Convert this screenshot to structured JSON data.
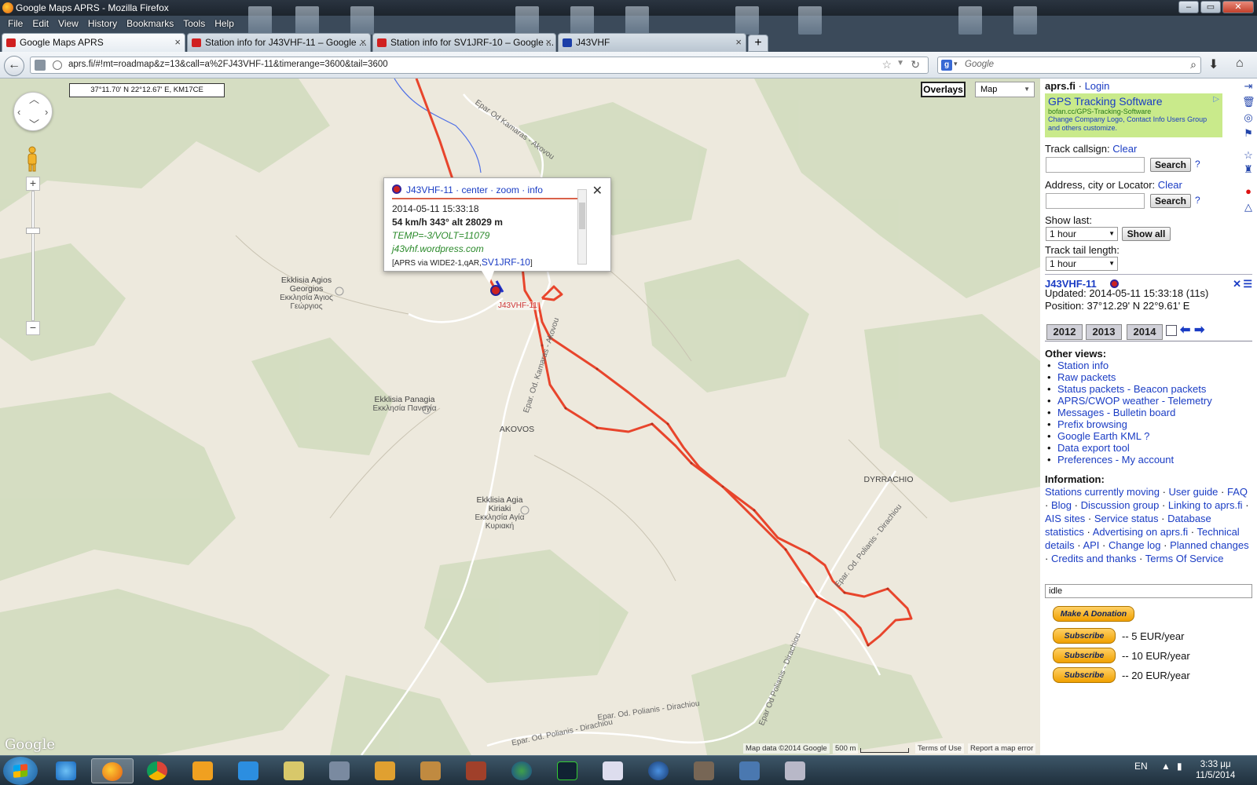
{
  "window": {
    "title": "Google Maps APRS - Mozilla Firefox"
  },
  "menu": [
    "File",
    "Edit",
    "View",
    "History",
    "Bookmarks",
    "Tools",
    "Help"
  ],
  "tabs": [
    {
      "label": "Google Maps APRS",
      "icon": "car-icon"
    },
    {
      "label": "Station info for J43VHF-11 – Google ...",
      "icon": "car-icon"
    },
    {
      "label": "Station info for SV1JRF-10 – Google ...",
      "icon": "car-icon"
    },
    {
      "label": "J43VHF",
      "icon": "blog-icon"
    }
  ],
  "nav": {
    "url": "aprs.fi/#!mt=roadmap&z=13&call=a%2FJ43VHF-11&timerange=3600&tail=3600",
    "search_placeholder": "Google"
  },
  "map": {
    "coords": "37°11.70' N 22°12.67' E, KM17CE",
    "overlays_label": "Overlays",
    "maptype_value": "Map",
    "places": [
      {
        "name": "Ekklisia Agios Georgios",
        "alt": "Εκκλησία Άγιος Γεώργιος"
      },
      {
        "name": "Ekklisia Panagia",
        "alt": "Εκκλησία Παναγία"
      },
      {
        "name": "AKOVOS"
      },
      {
        "name": "Ekklisia Agia Kiriaki",
        "alt": "Εκκλησία Αγία Κυριακή"
      },
      {
        "name": "DYRRACHIO"
      }
    ],
    "road_labels": [
      "Epar Od Kamaras - Akovou",
      "Epar. Od. Kamaras - Akovou",
      "Epar. Od. Polianis - Dirachiou",
      "Epar Od Polianis - Dirachiou",
      "Epar. Od. Polianis - Dirachiou",
      "Epar. Od. Polianis - Dirachiou"
    ],
    "station_label": "J43VHF-11",
    "footer": {
      "logo": "Google",
      "mapdata": "Map data ©2014 Google",
      "scale": "500 m",
      "terms": "Terms of Use",
      "report": "Report a map error"
    }
  },
  "infowindow": {
    "callsign": "J43VHF-11",
    "links": [
      "center",
      "zoom",
      "info"
    ],
    "time": "2014-05-11 15:33:18",
    "speed": "54 km/h 343° alt 28029 m",
    "comment": "TEMP=-3/VOLT=11079",
    "web": "j43vhf.wordpress.com",
    "via_prefix": "[APRS via WIDE2-1,qAR,",
    "via_call": "SV1JRF-10",
    "via_suffix": "]"
  },
  "sidebar": {
    "site": "aprs.fi",
    "login": "Login",
    "ad": {
      "title": "GPS Tracking Software",
      "url": "bofan.cc/GPS-Tracking-Software",
      "desc": "Change Company Logo, Contact Info Users Group and others customize."
    },
    "track_callsign_label": "Track callsign:",
    "address_label": "Address, city or Locator:",
    "clear": "Clear",
    "search": "Search",
    "qmark": "?",
    "show_last_label": "Show last:",
    "show_last_value": "1 hour",
    "show_all": "Show all",
    "tail_label": "Track tail length:",
    "tail_value": "1 hour",
    "station": {
      "callsign": "J43VHF-11",
      "updated": "Updated: 2014-05-11 15:33:18 (11s)",
      "position": "Position: 37°12.29' N 22°9.61' E"
    },
    "years": [
      "2012",
      "2013",
      "2014"
    ],
    "other_views_label": "Other views:",
    "views": [
      "Station info",
      "Raw packets",
      "Status packets - Beacon packets",
      "APRS/CWOP weather - Telemetry",
      "Messages - Bulletin board",
      "Prefix browsing",
      "Google Earth KML ?",
      "Data export tool",
      "Preferences - My account"
    ],
    "information_label": "Information:",
    "info_links": [
      "Stations currently moving",
      "User guide",
      "FAQ",
      "Blog",
      "Discussion group",
      "Linking to aprs.fi",
      "AIS sites",
      "Service status",
      "Database statistics",
      "Advertising on aprs.fi",
      "Technical details",
      "API",
      "Change log",
      "Planned changes",
      "Credits and thanks",
      "Terms Of Service"
    ],
    "status": "idle",
    "donate": "Make A Donation",
    "subscribe": "Subscribe",
    "prices": [
      "-- 5 EUR/year",
      "-- 10 EUR/year",
      "-- 20 EUR/year"
    ]
  },
  "taskbar": {
    "lang": "EN",
    "time": "3:33 μμ",
    "date": "11/5/2014"
  },
  "colors": {
    "track": "#e8452c",
    "link": "#1a3cc4",
    "ad_bg": "#c9ea8b"
  }
}
